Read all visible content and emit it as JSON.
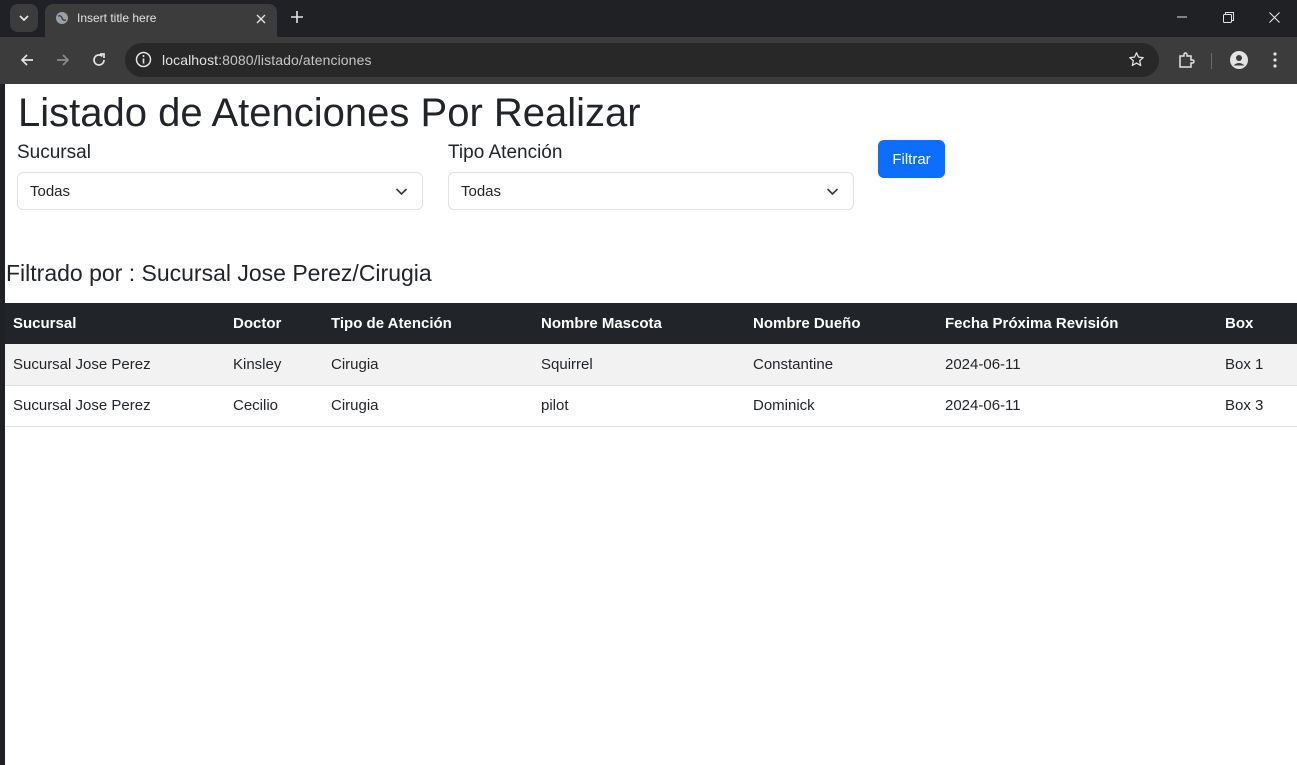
{
  "browser": {
    "tab_title": "Insert title here",
    "url_host": "localhost",
    "url_rest": ":8080/listado/atenciones"
  },
  "page": {
    "title": "Listado de Atenciones Por Realizar",
    "filters": {
      "sucursal_label": "Sucursal",
      "sucursal_value": "Todas",
      "tipo_label": "Tipo Atención",
      "tipo_value": "Todas",
      "button_label": "Filtrar"
    },
    "filter_status": "Filtrado por : Sucursal Jose Perez/Cirugia",
    "table": {
      "headers": [
        "Sucursal",
        "Doctor",
        "Tipo de Atención",
        "Nombre Mascota",
        "Nombre Dueño",
        "Fecha Próxima Revisión",
        "Box"
      ],
      "rows": [
        [
          "Sucursal Jose Perez",
          "Kinsley",
          "Cirugia",
          "Squirrel",
          "Constantine",
          "2024-06-11",
          "Box 1"
        ],
        [
          "Sucursal Jose Perez",
          "Cecilio",
          "Cirugia",
          "pilot",
          "Dominick",
          "2024-06-11",
          "Box 3"
        ]
      ]
    }
  },
  "colors": {
    "primary": "#0d6efd",
    "table_header": "#212529",
    "striped_row": "#f2f2f2"
  },
  "icons": [
    "tab-search-icon",
    "globe-icon",
    "close-icon",
    "plus-icon",
    "minimize-icon",
    "restore-icon",
    "window-close-icon",
    "back-icon",
    "forward-icon",
    "reload-icon",
    "info-icon",
    "star-icon",
    "extensions-icon",
    "profile-icon",
    "menu-icon",
    "chevron-down-icon"
  ]
}
